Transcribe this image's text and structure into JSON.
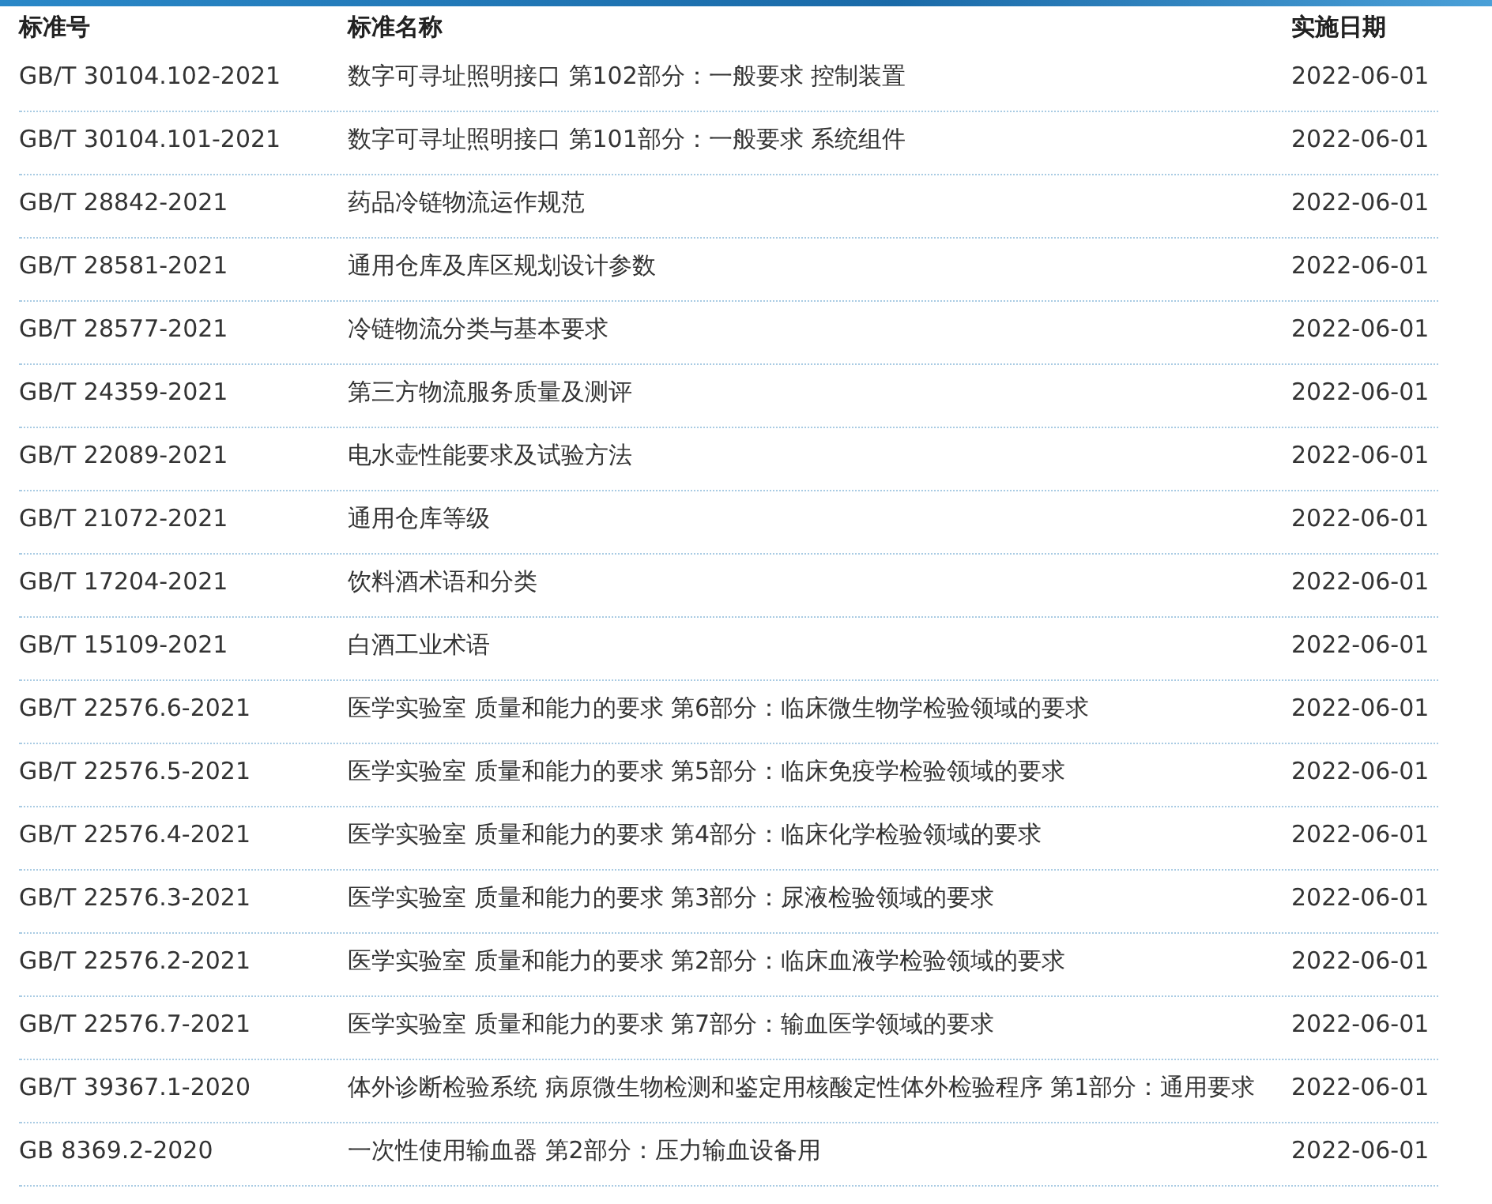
{
  "table": {
    "columns": [
      "标准号",
      "标准名称",
      "实施日期"
    ],
    "rows": [
      {
        "code": "GB/T 30104.102-2021",
        "name": "数字可寻址照明接口 第102部分：一般要求 控制装置",
        "date": "2022-06-01"
      },
      {
        "code": "GB/T 30104.101-2021",
        "name": "数字可寻址照明接口 第101部分：一般要求 系统组件",
        "date": "2022-06-01"
      },
      {
        "code": "GB/T 28842-2021",
        "name": "药品冷链物流运作规范",
        "date": "2022-06-01"
      },
      {
        "code": "GB/T 28581-2021",
        "name": "通用仓库及库区规划设计参数",
        "date": "2022-06-01"
      },
      {
        "code": "GB/T 28577-2021",
        "name": "冷链物流分类与基本要求",
        "date": "2022-06-01"
      },
      {
        "code": "GB/T 24359-2021",
        "name": "第三方物流服务质量及测评",
        "date": "2022-06-01"
      },
      {
        "code": "GB/T 22089-2021",
        "name": "电水壶性能要求及试验方法",
        "date": "2022-06-01"
      },
      {
        "code": "GB/T 21072-2021",
        "name": "通用仓库等级",
        "date": "2022-06-01"
      },
      {
        "code": "GB/T 17204-2021",
        "name": "饮料酒术语和分类",
        "date": "2022-06-01"
      },
      {
        "code": "GB/T 15109-2021",
        "name": "白酒工业术语",
        "date": "2022-06-01"
      },
      {
        "code": "GB/T 22576.6-2021",
        "name": "医学实验室 质量和能力的要求 第6部分：临床微生物学检验领域的要求",
        "date": "2022-06-01"
      },
      {
        "code": "GB/T 22576.5-2021",
        "name": "医学实验室 质量和能力的要求 第5部分：临床免疫学检验领域的要求",
        "date": "2022-06-01"
      },
      {
        "code": "GB/T 22576.4-2021",
        "name": "医学实验室 质量和能力的要求 第4部分：临床化学检验领域的要求",
        "date": "2022-06-01"
      },
      {
        "code": "GB/T 22576.3-2021",
        "name": "医学实验室 质量和能力的要求 第3部分：尿液检验领域的要求",
        "date": "2022-06-01"
      },
      {
        "code": "GB/T 22576.2-2021",
        "name": "医学实验室 质量和能力的要求 第2部分：临床血液学检验领域的要求",
        "date": "2022-06-01"
      },
      {
        "code": "GB/T 22576.7-2021",
        "name": "医学实验室 质量和能力的要求 第7部分：输血医学领域的要求",
        "date": "2022-06-01"
      },
      {
        "code": "GB/T 39367.1-2020",
        "name": "体外诊断检验系统 病原微生物检测和鉴定用核酸定性体外检验程序 第1部分：通用要求",
        "date": "2022-06-01"
      },
      {
        "code": "GB 8369.2-2020",
        "name": "一次性使用输血器 第2部分：压力输血设备用",
        "date": "2022-06-01"
      }
    ]
  }
}
